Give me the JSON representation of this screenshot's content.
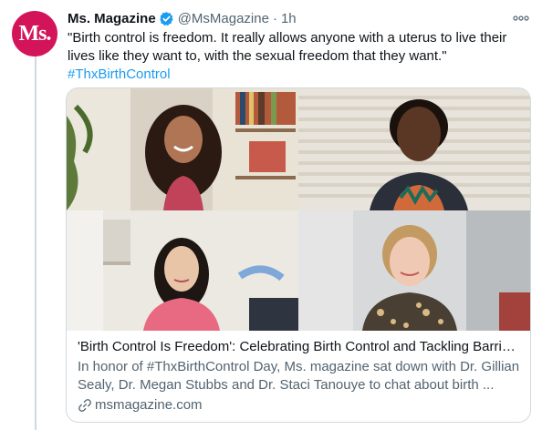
{
  "tweet": {
    "author_name": "Ms. Magazine",
    "author_handle": "@MsMagazine",
    "separator": "·",
    "time": "1h",
    "avatar_text": "Ms.",
    "more_label": "ooo",
    "text": "\"Birth control is freedom. It really allows anyone with a uterus to live their lives like they want to, with the sexual freedom that they want.\"",
    "hashtag": "#ThxBirthControl"
  },
  "card": {
    "title": "'Birth Control Is Freedom': Celebrating Birth Control and Tackling Barrier...",
    "description": "In honor of #ThxBirthControl Day, Ms. magazine sat down with Dr. Gillian Sealy, Dr. Megan Stubbs and Dr. Staci Tanouye to chat about birth ...",
    "domain": "msmagazine.com"
  },
  "colors": {
    "accent": "#1d9bf0",
    "brand": "#d4145a",
    "muted_text": "#536471",
    "border": "#cfd9de"
  },
  "icons": {
    "verified": "verified-badge-icon",
    "link": "link-icon",
    "more": "more-options-icon"
  }
}
